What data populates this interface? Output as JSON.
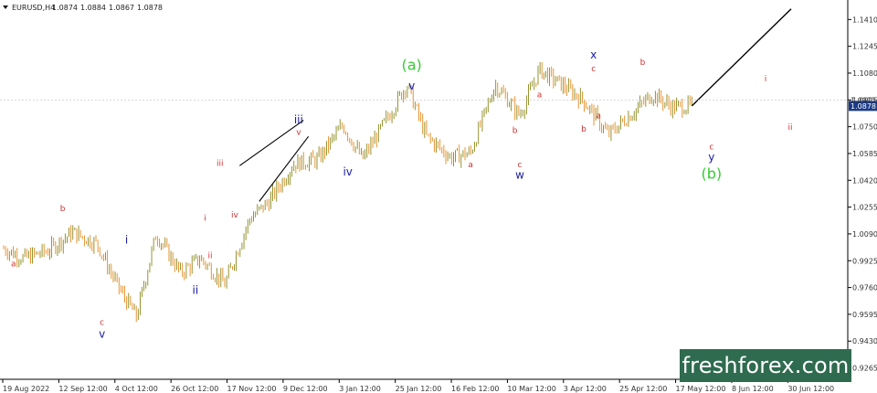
{
  "header": {
    "title": "EURUSD,H4",
    "ohlc": [
      "1.0874",
      "1.0884",
      "1.0867",
      "1.0878"
    ]
  },
  "price_marker": {
    "value": "1.0878",
    "dashed_level": "1.0915"
  },
  "branding": {
    "text": "freshforex.com"
  },
  "colors": {
    "candle_up": "#7a7a00",
    "candle_down": "#e07b00",
    "wave_red": "#d13030",
    "wave_blue": "#1c1ca0",
    "wave_green": "#33cc33",
    "brand_bg": "#2f6b4f"
  },
  "chart_data": {
    "type": "line",
    "instrument": "EURUSD",
    "timeframe": "H4",
    "ylim": [
      0.9195,
      1.153
    ],
    "y_ticks": [
      "1.1410",
      "1.1245",
      "1.1080",
      "1.0915",
      "1.0750",
      "1.0585",
      "1.0420",
      "1.0255",
      "1.0090",
      "0.9925",
      "0.9760",
      "0.9595",
      "0.9430",
      "0.9265"
    ],
    "x_ticks": [
      "19 Aug 2022",
      "12 Sep 12:00",
      "4 Oct 12:00",
      "26 Oct 12:00",
      "17 Nov 12:00",
      "9 Dec 12:00",
      "3 Jan 12:00",
      "25 Jan 12:00",
      "16 Feb 12:00",
      "10 Mar 12:00",
      "3 Apr 12:00",
      "25 Apr 12:00",
      "17 May 12:00",
      "8 Jun 12:00",
      "30 Jun 12:00"
    ],
    "x": [
      0,
      0.4,
      0.9,
      1.4,
      1.9,
      2.3,
      2.7,
      3.1,
      3.6,
      4.0,
      4.5,
      5.0,
      5.4,
      5.9,
      6.4,
      6.9,
      7.3,
      7.8,
      8.2,
      8.6,
      9.1,
      9.5,
      10.0,
      10.5,
      10.9,
      11.4,
      11.8,
      12.3,
      12.7,
      13.2,
      13.6,
      14.0
    ],
    "series": [
      {
        "values": [
          1.0,
          0.994,
          0.9985,
          1.01,
          1.003,
          0.978,
          0.958,
          1.009,
          0.985,
          0.994,
          0.978,
          1.018,
          1.029,
          1.052,
          1.055,
          1.076,
          1.055,
          1.08,
          1.101,
          1.069,
          1.056,
          1.059,
          1.101,
          1.082,
          1.11,
          1.1,
          1.091,
          1.07,
          1.081,
          1.095,
          1.087,
          1.0878
        ]
      },
      {
        "values": [
          1.0878,
          1.1475
        ]
      }
    ],
    "projection_x": [
      14.0,
      14.5
    ],
    "wave_labels": [
      {
        "text": "a",
        "group": "red",
        "x": 0.2,
        "y": 0.989
      },
      {
        "text": "b",
        "group": "red",
        "x": 1.2,
        "y": 1.023
      },
      {
        "text": "c",
        "group": "red",
        "x": 2.0,
        "y": 0.953
      },
      {
        "text": "v",
        "group": "blue",
        "x": 2.0,
        "y": 0.945
      },
      {
        "text": "i",
        "group": "blue",
        "x": 2.5,
        "y": 1.003
      },
      {
        "text": "ii",
        "group": "blue",
        "x": 3.9,
        "y": 0.972
      },
      {
        "text": "i",
        "group": "red",
        "x": 4.1,
        "y": 1.017
      },
      {
        "text": "ii",
        "group": "red",
        "x": 4.2,
        "y": 0.994
      },
      {
        "text": "iii",
        "group": "red",
        "x": 4.4,
        "y": 1.051
      },
      {
        "text": "iv",
        "group": "red",
        "x": 4.7,
        "y": 1.019
      },
      {
        "text": "iii",
        "group": "blue",
        "x": 6.0,
        "y": 1.077
      },
      {
        "text": "v",
        "group": "red",
        "x": 6.0,
        "y": 1.07
      },
      {
        "text": "iv",
        "group": "blue",
        "x": 7.0,
        "y": 1.045
      },
      {
        "text": "(a)",
        "group": "green",
        "x": 8.3,
        "y": 1.11
      },
      {
        "text": "v",
        "group": "blue",
        "x": 8.3,
        "y": 1.098
      },
      {
        "text": "a",
        "group": "red",
        "x": 9.5,
        "y": 1.05
      },
      {
        "text": "b",
        "group": "red",
        "x": 10.4,
        "y": 1.071
      },
      {
        "text": "c",
        "group": "red",
        "x": 10.5,
        "y": 1.05
      },
      {
        "text": "w",
        "group": "blue",
        "x": 10.5,
        "y": 1.043
      },
      {
        "text": "a",
        "group": "red",
        "x": 10.9,
        "y": 1.093
      },
      {
        "text": "b",
        "group": "red",
        "x": 11.8,
        "y": 1.072
      },
      {
        "text": "x",
        "group": "blue",
        "x": 12.0,
        "y": 1.117
      },
      {
        "text": "c",
        "group": "red",
        "x": 12.0,
        "y": 1.109
      },
      {
        "text": "a",
        "group": "red",
        "x": 12.1,
        "y": 1.08
      },
      {
        "text": "b",
        "group": "red",
        "x": 13.0,
        "y": 1.113
      },
      {
        "text": "c",
        "group": "red",
        "x": 14.4,
        "y": 1.061
      },
      {
        "text": "y",
        "group": "blue",
        "x": 14.4,
        "y": 1.054
      },
      {
        "text": "(b)",
        "group": "green",
        "x": 14.4,
        "y": 1.043
      },
      {
        "text": "i",
        "group": "red",
        "x": 15.5,
        "y": 1.103
      },
      {
        "text": "ii",
        "group": "red",
        "x": 16.0,
        "y": 1.073
      }
    ],
    "trendlines": [
      {
        "from": [
          4.8,
          1.051
        ],
        "to": [
          6.1,
          1.079
        ]
      },
      {
        "from": [
          5.2,
          1.029
        ],
        "to": [
          6.2,
          1.069
        ]
      }
    ],
    "legend": "",
    "grid": false
  }
}
